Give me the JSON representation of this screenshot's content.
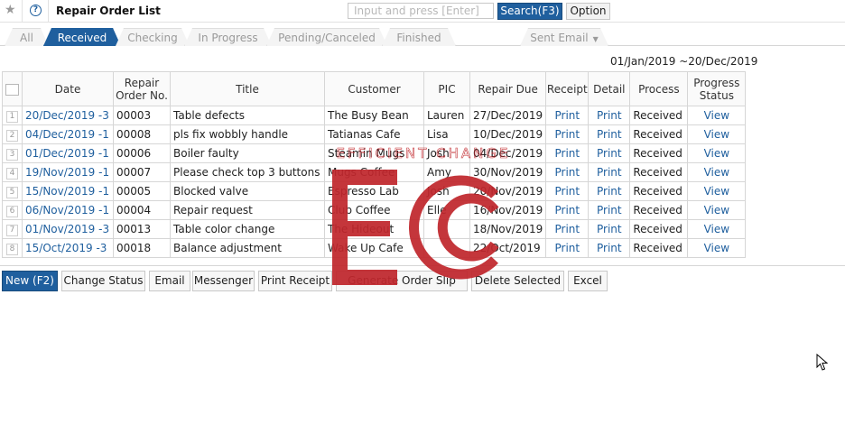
{
  "header": {
    "title": "Repair Order List",
    "search_placeholder": "Input and press [Enter]",
    "search_button": "Search(F3)",
    "option_button": "Option"
  },
  "tabs": [
    {
      "label": "All",
      "active": false
    },
    {
      "label": "Received",
      "active": true
    },
    {
      "label": "Checking",
      "active": false
    },
    {
      "label": "In Progress",
      "active": false
    },
    {
      "label": "Pending/Canceled",
      "active": false
    },
    {
      "label": "Finished",
      "active": false
    },
    {
      "label": "Sent Email",
      "active": false,
      "dropdown": true
    }
  ],
  "date_range": "01/Jan/2019 ~20/Dec/2019",
  "table": {
    "headers": {
      "date": "Date",
      "ro_no_line1": "Repair",
      "ro_no_line2": "Order No.",
      "title": "Title",
      "customer": "Customer",
      "pic": "PIC",
      "repair_due": "Repair Due",
      "receipt": "Receipt",
      "detail": "Detail",
      "process": "Process",
      "progress_line1": "Progress",
      "progress_line2": "Status"
    },
    "rows": [
      {
        "num": "1",
        "date": "20/Dec/2019 -3",
        "ro": "00003",
        "title": "Table defects",
        "customer": "The Busy Bean",
        "pic": "Lauren",
        "due": "27/Dec/2019",
        "receipt": "Print",
        "detail": "Print",
        "process": "Received",
        "progress": "View"
      },
      {
        "num": "2",
        "date": "04/Dec/2019 -1",
        "ro": "00008",
        "title": "pls fix wobbly handle",
        "customer": "Tatianas Cafe",
        "pic": "Lisa",
        "due": "10/Dec/2019",
        "receipt": "Print",
        "detail": "Print",
        "process": "Received",
        "progress": "View"
      },
      {
        "num": "3",
        "date": "01/Dec/2019 -1",
        "ro": "00006",
        "title": "Boiler faulty",
        "customer": "Steamin Mugs",
        "pic": "Josh",
        "due": "04/Dec/2019",
        "receipt": "Print",
        "detail": "Print",
        "process": "Received",
        "progress": "View"
      },
      {
        "num": "4",
        "date": "19/Nov/2019 -1",
        "ro": "00007",
        "title": "Please check top 3 buttons",
        "customer": "Mugs Coffee",
        "pic": "Amy",
        "due": "30/Nov/2019",
        "receipt": "Print",
        "detail": "Print",
        "process": "Received",
        "progress": "View"
      },
      {
        "num": "5",
        "date": "15/Nov/2019 -1",
        "ro": "00005",
        "title": "Blocked valve",
        "customer": "Espresso Lab",
        "pic": "Josh",
        "due": "20/Nov/2019",
        "receipt": "Print",
        "detail": "Print",
        "process": "Received",
        "progress": "View"
      },
      {
        "num": "6",
        "date": "06/Nov/2019 -1",
        "ro": "00004",
        "title": "Repair request",
        "customer": "Club Coffee",
        "pic": "Elle",
        "due": "16/Nov/2019",
        "receipt": "Print",
        "detail": "Print",
        "process": "Received",
        "progress": "View"
      },
      {
        "num": "7",
        "date": "01/Nov/2019 -3",
        "ro": "00013",
        "title": "Table color change",
        "customer": "The Hideout",
        "pic": "",
        "due": "18/Nov/2019",
        "receipt": "Print",
        "detail": "Print",
        "process": "Received",
        "progress": "View"
      },
      {
        "num": "8",
        "date": "15/Oct/2019 -3",
        "ro": "00018",
        "title": "Balance adjustment",
        "customer": "Wake Up Cafe",
        "pic": "",
        "due": "22/Oct/2019",
        "receipt": "Print",
        "detail": "Print",
        "process": "Received",
        "progress": "View"
      }
    ]
  },
  "actions": {
    "new": "New (F2)",
    "change_status": "Change Status",
    "email": "Email",
    "messenger": "Messenger",
    "print_receipt": "Print Receipt",
    "generate_order_slip": "Generate Order Slip",
    "delete_selected": "Delete Selected",
    "excel": "Excel"
  },
  "watermark": {
    "text": "EFFICIENT CHANGE",
    "color": "#c0272d"
  },
  "colors": {
    "accent": "#1f5f9e",
    "link": "#1f5f9e"
  }
}
